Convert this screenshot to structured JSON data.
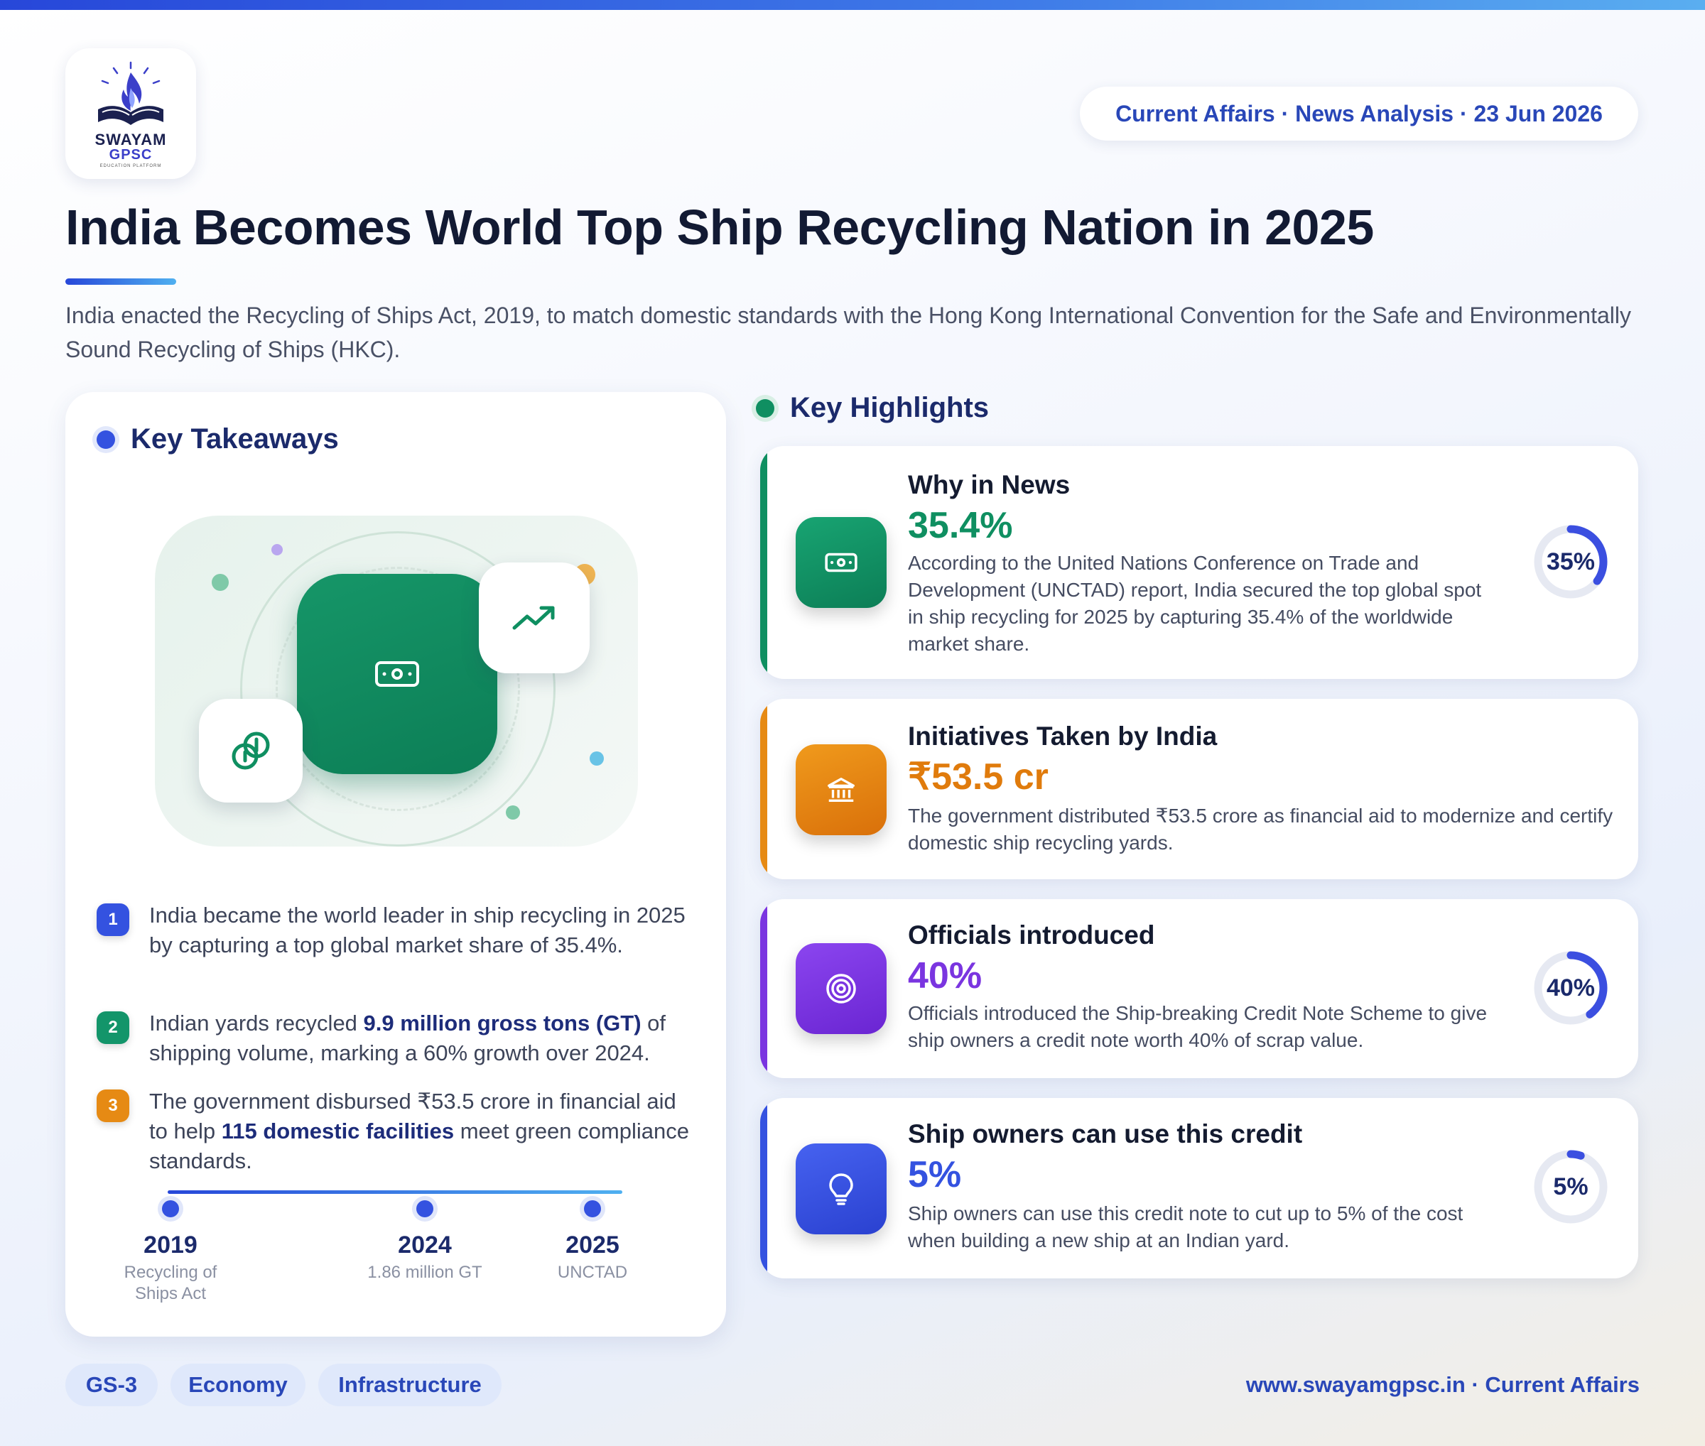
{
  "brand": {
    "name": "SWAYAM",
    "sub": "GPSC",
    "tagline": "EDUCATION PLATFORM"
  },
  "header": {
    "date_pill": "Current Affairs · News Analysis · 23 Jun 2026",
    "title": "India Becomes World Top Ship Recycling Nation in 2025",
    "lead": "India enacted the Recycling of Ships Act, 2019, to match domestic standards with the Hong Kong International Convention for the Safe and Environmentally Sound Recycling of Ships (HKC)."
  },
  "takeaways": {
    "heading": "Key Takeaways",
    "items": [
      {
        "num": "1",
        "text": "India became the world leader in ship recycling in 2025 by capturing a top global market share of 35.4%."
      },
      {
        "num": "2",
        "pre": "Indian yards recycled ",
        "bold": "9.9 million gross tons (GT)",
        "post": " of shipping volume, marking a 60% growth over 2024."
      },
      {
        "num": "3",
        "pre": "The government disbursed ₹53.5 crore in financial aid to help ",
        "bold": "115 domestic facilities",
        "post": " meet green compliance standards."
      }
    ],
    "timeline": [
      {
        "year": "2019",
        "label": "Recycling of Ships Act"
      },
      {
        "year": "2024",
        "label": "1.86 million GT"
      },
      {
        "year": "2025",
        "label": "UNCTAD"
      }
    ]
  },
  "highlights": {
    "heading": "Key Highlights",
    "cards": [
      {
        "title": "Why in News",
        "stat": "35.4%",
        "desc": "According to the United Nations Conference on Trade and Development (UNCTAD) report, India secured the top global spot in ship recycling for 2025 by capturing 35.4% of the worldwide market share.",
        "gauge_label": "35%",
        "gauge_value": 0.35,
        "color": "#0f8f61",
        "icon": "cash-icon"
      },
      {
        "title": "Initiatives Taken by India",
        "stat": "₹53.5 cr",
        "desc": "The government distributed ₹53.5 crore as financial aid to modernize and certify domestic ship recycling yards.",
        "color": "#e07b0c",
        "icon": "bank-icon"
      },
      {
        "title": "Officials introduced",
        "stat": "40%",
        "desc": "Officials introduced the Ship-breaking Credit Note Scheme to give ship owners a credit note worth 40% of scrap value.",
        "gauge_label": "40%",
        "gauge_value": 0.4,
        "color": "#7a35e0",
        "icon": "target-icon"
      },
      {
        "title": "Ship owners can use this credit",
        "stat": "5%",
        "desc": "Ship owners can use this credit note to cut up to 5% of the cost when building a new ship at an Indian yard.",
        "gauge_label": "5%",
        "gauge_value": 0.05,
        "color": "#3452e0",
        "icon": "lightbulb-icon"
      }
    ]
  },
  "footer": {
    "tags": [
      "GS-3",
      "Economy",
      "Infrastructure"
    ],
    "site": "www.swayamgpsc.in · Current Affairs"
  },
  "colors": {
    "accent_blue": "#2947b8",
    "gauge_track": "#e6e9f2",
    "gauge_fill": "#3b4fe0"
  }
}
